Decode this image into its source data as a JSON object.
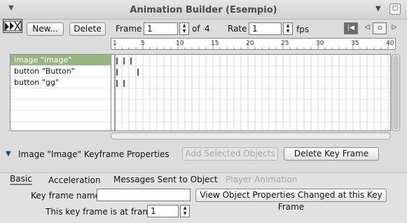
{
  "window": {
    "title": "Animation Builder (Esempio)",
    "menu_icon": "triangle-down-icon",
    "collapse_icon": "triangle-down-icon",
    "close_icon": "close-icon"
  },
  "toolbar": {
    "new_label": "New...",
    "delete_label": "Delete",
    "frame_label": "Frame",
    "frame_value": "1",
    "of_label": "of",
    "frame_total": "4",
    "rate_label": "Rate",
    "rate_value": "1",
    "fps_label": "fps"
  },
  "playback": {
    "rewind_icon": "rewind-icon",
    "prev_icon": "prev-icon",
    "stop_icon": "stop-icon",
    "play_icon": "play-icon"
  },
  "ruler": {
    "ticks": [
      "1",
      "5",
      "10",
      "15",
      "20",
      "25",
      "30",
      "35",
      "40"
    ]
  },
  "objects": [
    {
      "label": "image \"Image\"",
      "keyframes": [
        1,
        2,
        3
      ]
    },
    {
      "label": "button \"Button\"",
      "keyframes": [
        1,
        4
      ]
    },
    {
      "label": "button \"gg\"",
      "keyframes": [
        1,
        2
      ]
    }
  ],
  "keyframe_panel": {
    "title": "Image \"Image\" Keyframe Properties",
    "add_selected_label": "Add Selected Objects",
    "delete_key_frame_label": "Delete Key Frame"
  },
  "tabs": [
    {
      "label": "Basic",
      "active": true
    },
    {
      "label": "Acceleration",
      "active": false
    },
    {
      "label": "Messages Sent to Object",
      "active": false
    },
    {
      "label": "Player Animation",
      "active": false,
      "disabled": true
    }
  ],
  "basic": {
    "key_frame_name_label": "Key frame name",
    "key_frame_name_value": "",
    "view_props_label": "View Object Properties Changed at this Key Frame",
    "at_frame_label": "This key frame is at frame",
    "at_frame_value": "1"
  },
  "colors": {
    "selected_row": "#9ab582",
    "window_bg": "#dcdcdc"
  }
}
